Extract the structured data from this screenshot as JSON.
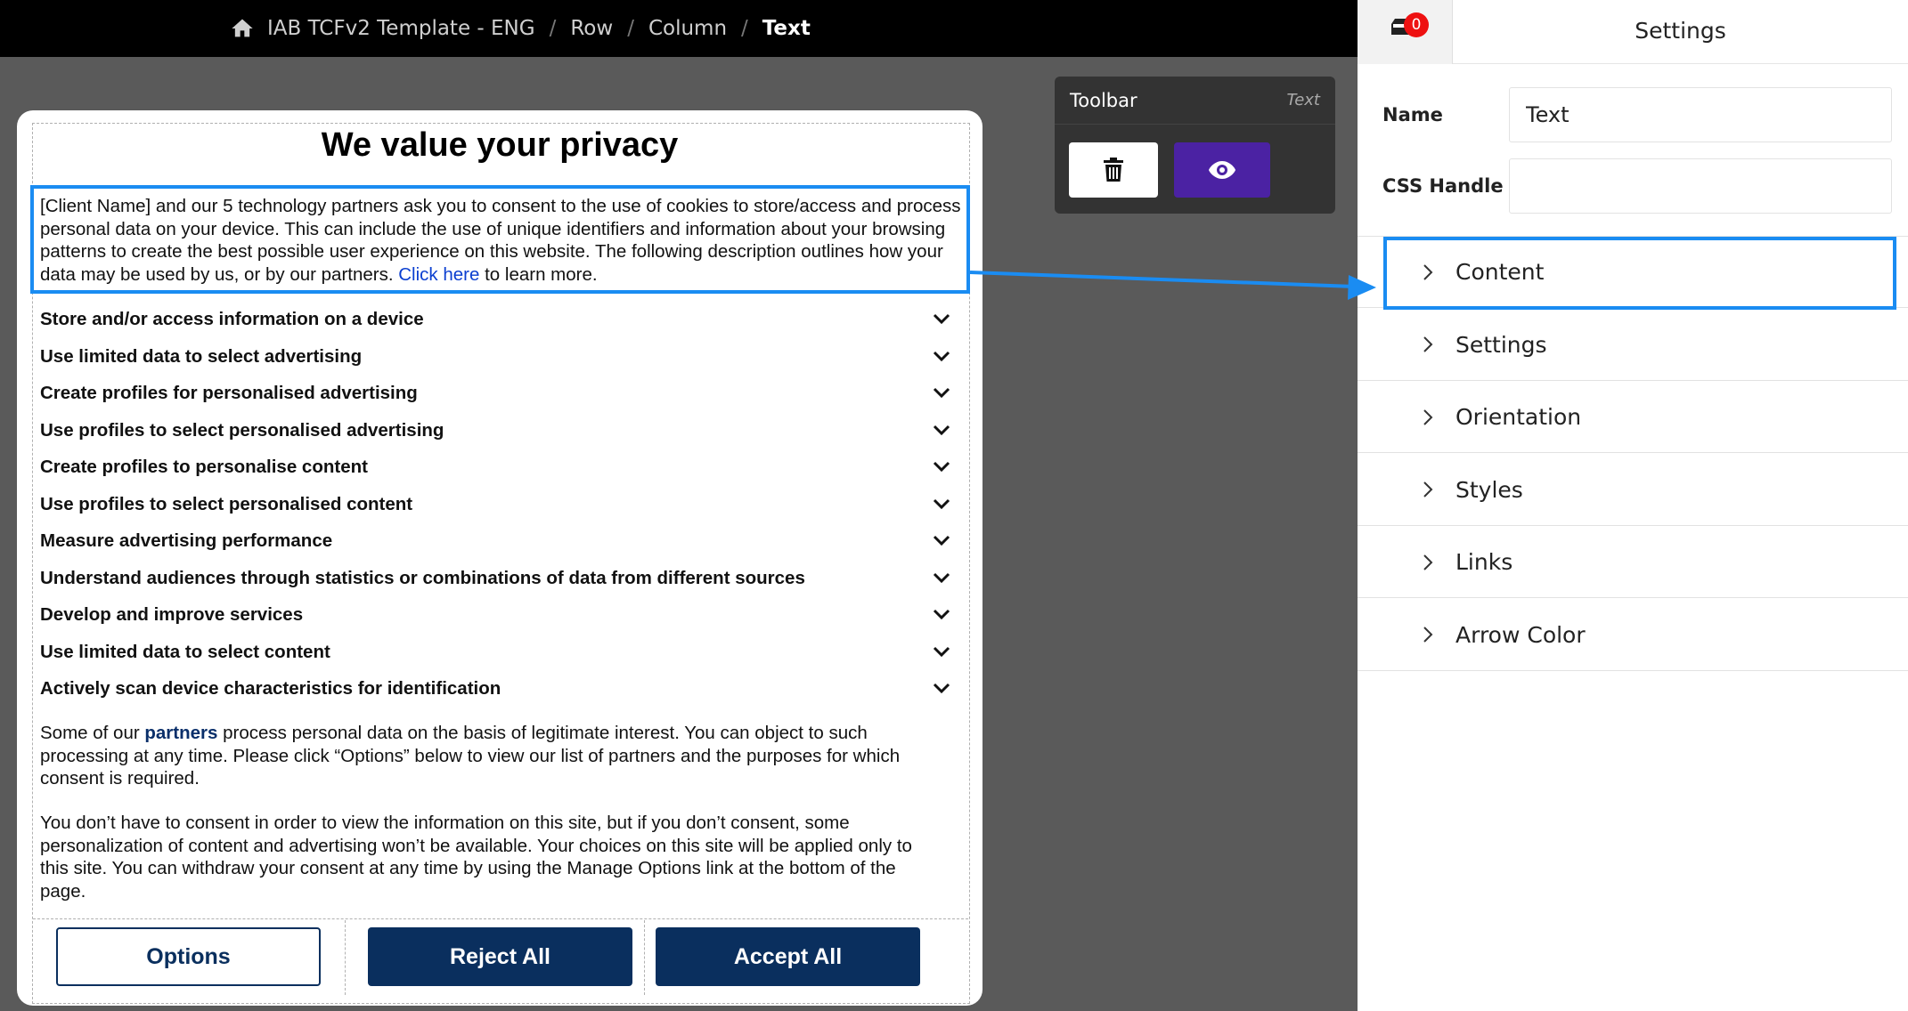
{
  "breadcrumb": {
    "items": [
      "IAB TCFv2 Template - ENG",
      "Row",
      "Column"
    ],
    "current": "Text",
    "separator": "/"
  },
  "toolbar": {
    "title": "Toolbar",
    "subtitle": "Text",
    "delete_icon": "trash-icon",
    "preview_icon": "eye-icon",
    "preview_color": "#4b22a3"
  },
  "consent": {
    "title": "We value your privacy",
    "intro_text": "[Client Name] and our 5 technology partners ask you to consent to the use of cookies to store/access and process personal data on your device. This can include the use of unique identifiers and information about your browsing patterns to create the best possible user experience on this website. The following description outlines how your data may be used by us, or by our partners.",
    "intro_link": "Click here",
    "intro_suffix": "to learn more.",
    "purposes": [
      "Store and/or access information on a device",
      "Use limited data to select advertising",
      "Create profiles for personalised advertising",
      "Use profiles to select personalised advertising",
      "Create profiles to personalise content",
      "Use profiles to select personalised content",
      "Measure advertising performance",
      "Understand audiences through statistics or combinations of data from different sources",
      "Develop and improve services",
      "Use limited data to select content",
      "Actively scan device characteristics for identification"
    ],
    "para1_prefix": "Some of our",
    "para1_link": "partners",
    "para1_suffix": "process personal data on the basis of legitimate interest. You can object to such processing at any time. Please click “Options” below to view our list of partners and the purposes for which consent is required.",
    "para2": "You don’t have to consent in order to view the information on this site, but if you don’t consent, some personalization of content and advertising won’t be available. Your choices on this site will be applied only to this site. You can withdraw your consent at any time by using the Manage Options link at the bottom of the page.",
    "buttons": {
      "options": "Options",
      "reject": "Reject All",
      "accept": "Accept All"
    },
    "brand_color": "#0a2f5e",
    "highlight_color": "#1a8cf2"
  },
  "settings_panel": {
    "title": "Settings",
    "notification_count": "0",
    "fields": [
      {
        "label": "Name",
        "value": "Text"
      },
      {
        "label": "CSS Handle",
        "value": ""
      }
    ],
    "sections": [
      "Content",
      "Settings",
      "Orientation",
      "Styles",
      "Links",
      "Arrow Color"
    ]
  }
}
